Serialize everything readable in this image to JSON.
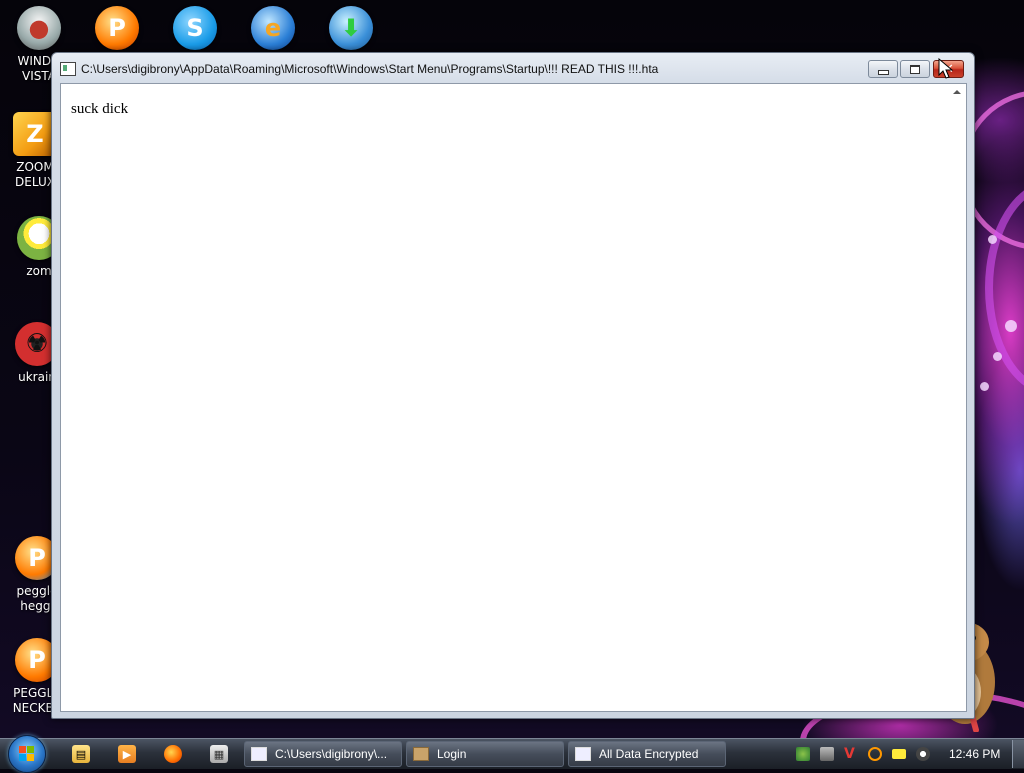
{
  "desktop": {
    "icons": [
      {
        "label_lines": [
          "WINDO",
          "VISTA"
        ],
        "icon": "vista-orb-icon",
        "color": "#c0392b"
      },
      {
        "label_lines": [
          "ZOOM",
          "DELUX"
        ],
        "icon": "zuma-icon",
        "color": "#f39c12"
      },
      {
        "label_lines": [
          "zom"
        ],
        "icon": "flower-icon",
        "color": "#7cb342"
      },
      {
        "label_lines": [
          "ukrain"
        ],
        "icon": "radiation-icon",
        "color": "#d32f2f"
      },
      {
        "label_lines": [
          "peggle",
          "heggl"
        ],
        "icon": "peggle-icon",
        "color": "#ff8a00"
      },
      {
        "label_lines": [
          "PEGGLE",
          "NECKBE"
        ],
        "icon": "peggle-icon",
        "color": "#ff8a00"
      }
    ],
    "top_icons": [
      "peggle-icon",
      "skype-icon",
      "internet-explorer-icon",
      "download-manager-icon"
    ]
  },
  "window": {
    "title": "C:\\Users\\digibrony\\AppData\\Roaming\\Microsoft\\Windows\\Start Menu\\Programs\\Startup\\!!! READ THIS !!!.hta",
    "content_text": "suck dick"
  },
  "taskbar": {
    "quick_launch": [
      "explorer-icon",
      "media-player-icon",
      "firefox-icon",
      "calculator-icon"
    ],
    "buttons": [
      {
        "label": "C:\\Users\\digibrony\\..."
      },
      {
        "label": "Login"
      },
      {
        "label": "All Data Encrypted"
      }
    ],
    "clock": "12:46 PM"
  }
}
